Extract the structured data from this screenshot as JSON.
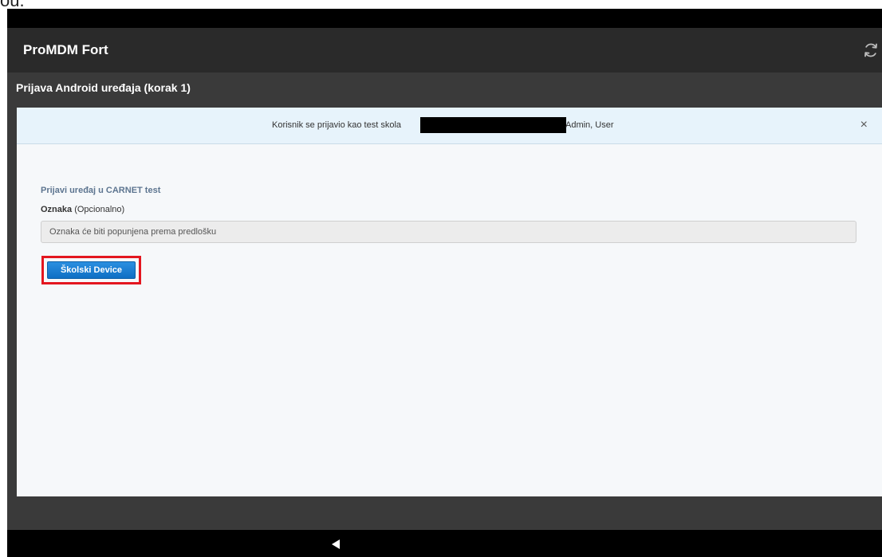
{
  "document_fragment": {
    "text": "ou."
  },
  "app_bar": {
    "title": "ProMDM Fort",
    "refresh_icon": "refresh-icon"
  },
  "page": {
    "header": "Prijava Android uređaja (korak 1)"
  },
  "alert": {
    "text": "Korisnik se prijavio kao test skola",
    "user_text": "Admin, User",
    "close_label": "×"
  },
  "form": {
    "section_title": "Prijavi uređaj u CARNET test",
    "field_label": "Oznaka",
    "field_hint": "(Opcionalno)",
    "field_placeholder": "Oznaka će biti popunjena prema predlošku",
    "submit_label": "Školski Device"
  },
  "nav": {
    "back_icon": "back-triangle-icon"
  },
  "colors": {
    "app_bar": "#2a2a2a",
    "content_bg": "#3a3a3a",
    "alert_bg": "#e7f3fb",
    "section_title": "#5d7590",
    "button": "#1a7fd4",
    "highlight": "#e3161f"
  }
}
